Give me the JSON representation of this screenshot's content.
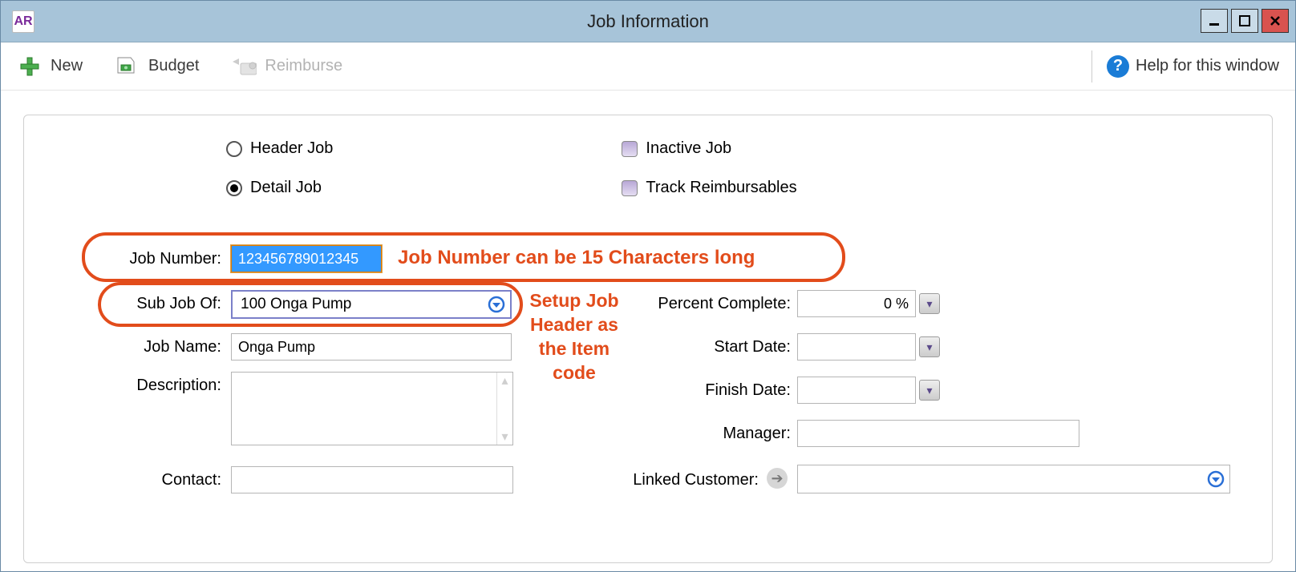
{
  "window": {
    "app_abbr": "AR",
    "title": "Job Information",
    "minimize": "—",
    "maximize": "□",
    "close": "✕"
  },
  "toolbar": {
    "new_label": "New",
    "budget_label": "Budget",
    "reimburse_label": "Reimburse",
    "help_label": "Help for this window"
  },
  "options": {
    "header_job_label": "Header Job",
    "detail_job_label": "Detail Job",
    "inactive_label": "Inactive Job",
    "track_reimb_label": "Track Reimbursables",
    "header_checked": false,
    "detail_checked": true
  },
  "form": {
    "job_number_label": "Job Number:",
    "job_number_value": "123456789012345",
    "sub_job_label": "Sub Job Of:",
    "sub_job_value": "100 Onga Pump",
    "job_name_label": "Job Name:",
    "job_name_value": "Onga Pump",
    "description_label": "Description:",
    "description_value": "",
    "contact_label": "Contact:",
    "contact_value": "",
    "percent_complete_label": "Percent Complete:",
    "percent_complete_value": "0 %",
    "start_date_label": "Start Date:",
    "start_date_value": "",
    "finish_date_label": "Finish Date:",
    "finish_date_value": "",
    "manager_label": "Manager:",
    "manager_value": "",
    "linked_customer_label": "Linked Customer:",
    "linked_customer_value": ""
  },
  "annotations": {
    "job_number_note": "Job Number can be 15 Characters long",
    "header_note": "Setup  Job Header as the Item code"
  }
}
